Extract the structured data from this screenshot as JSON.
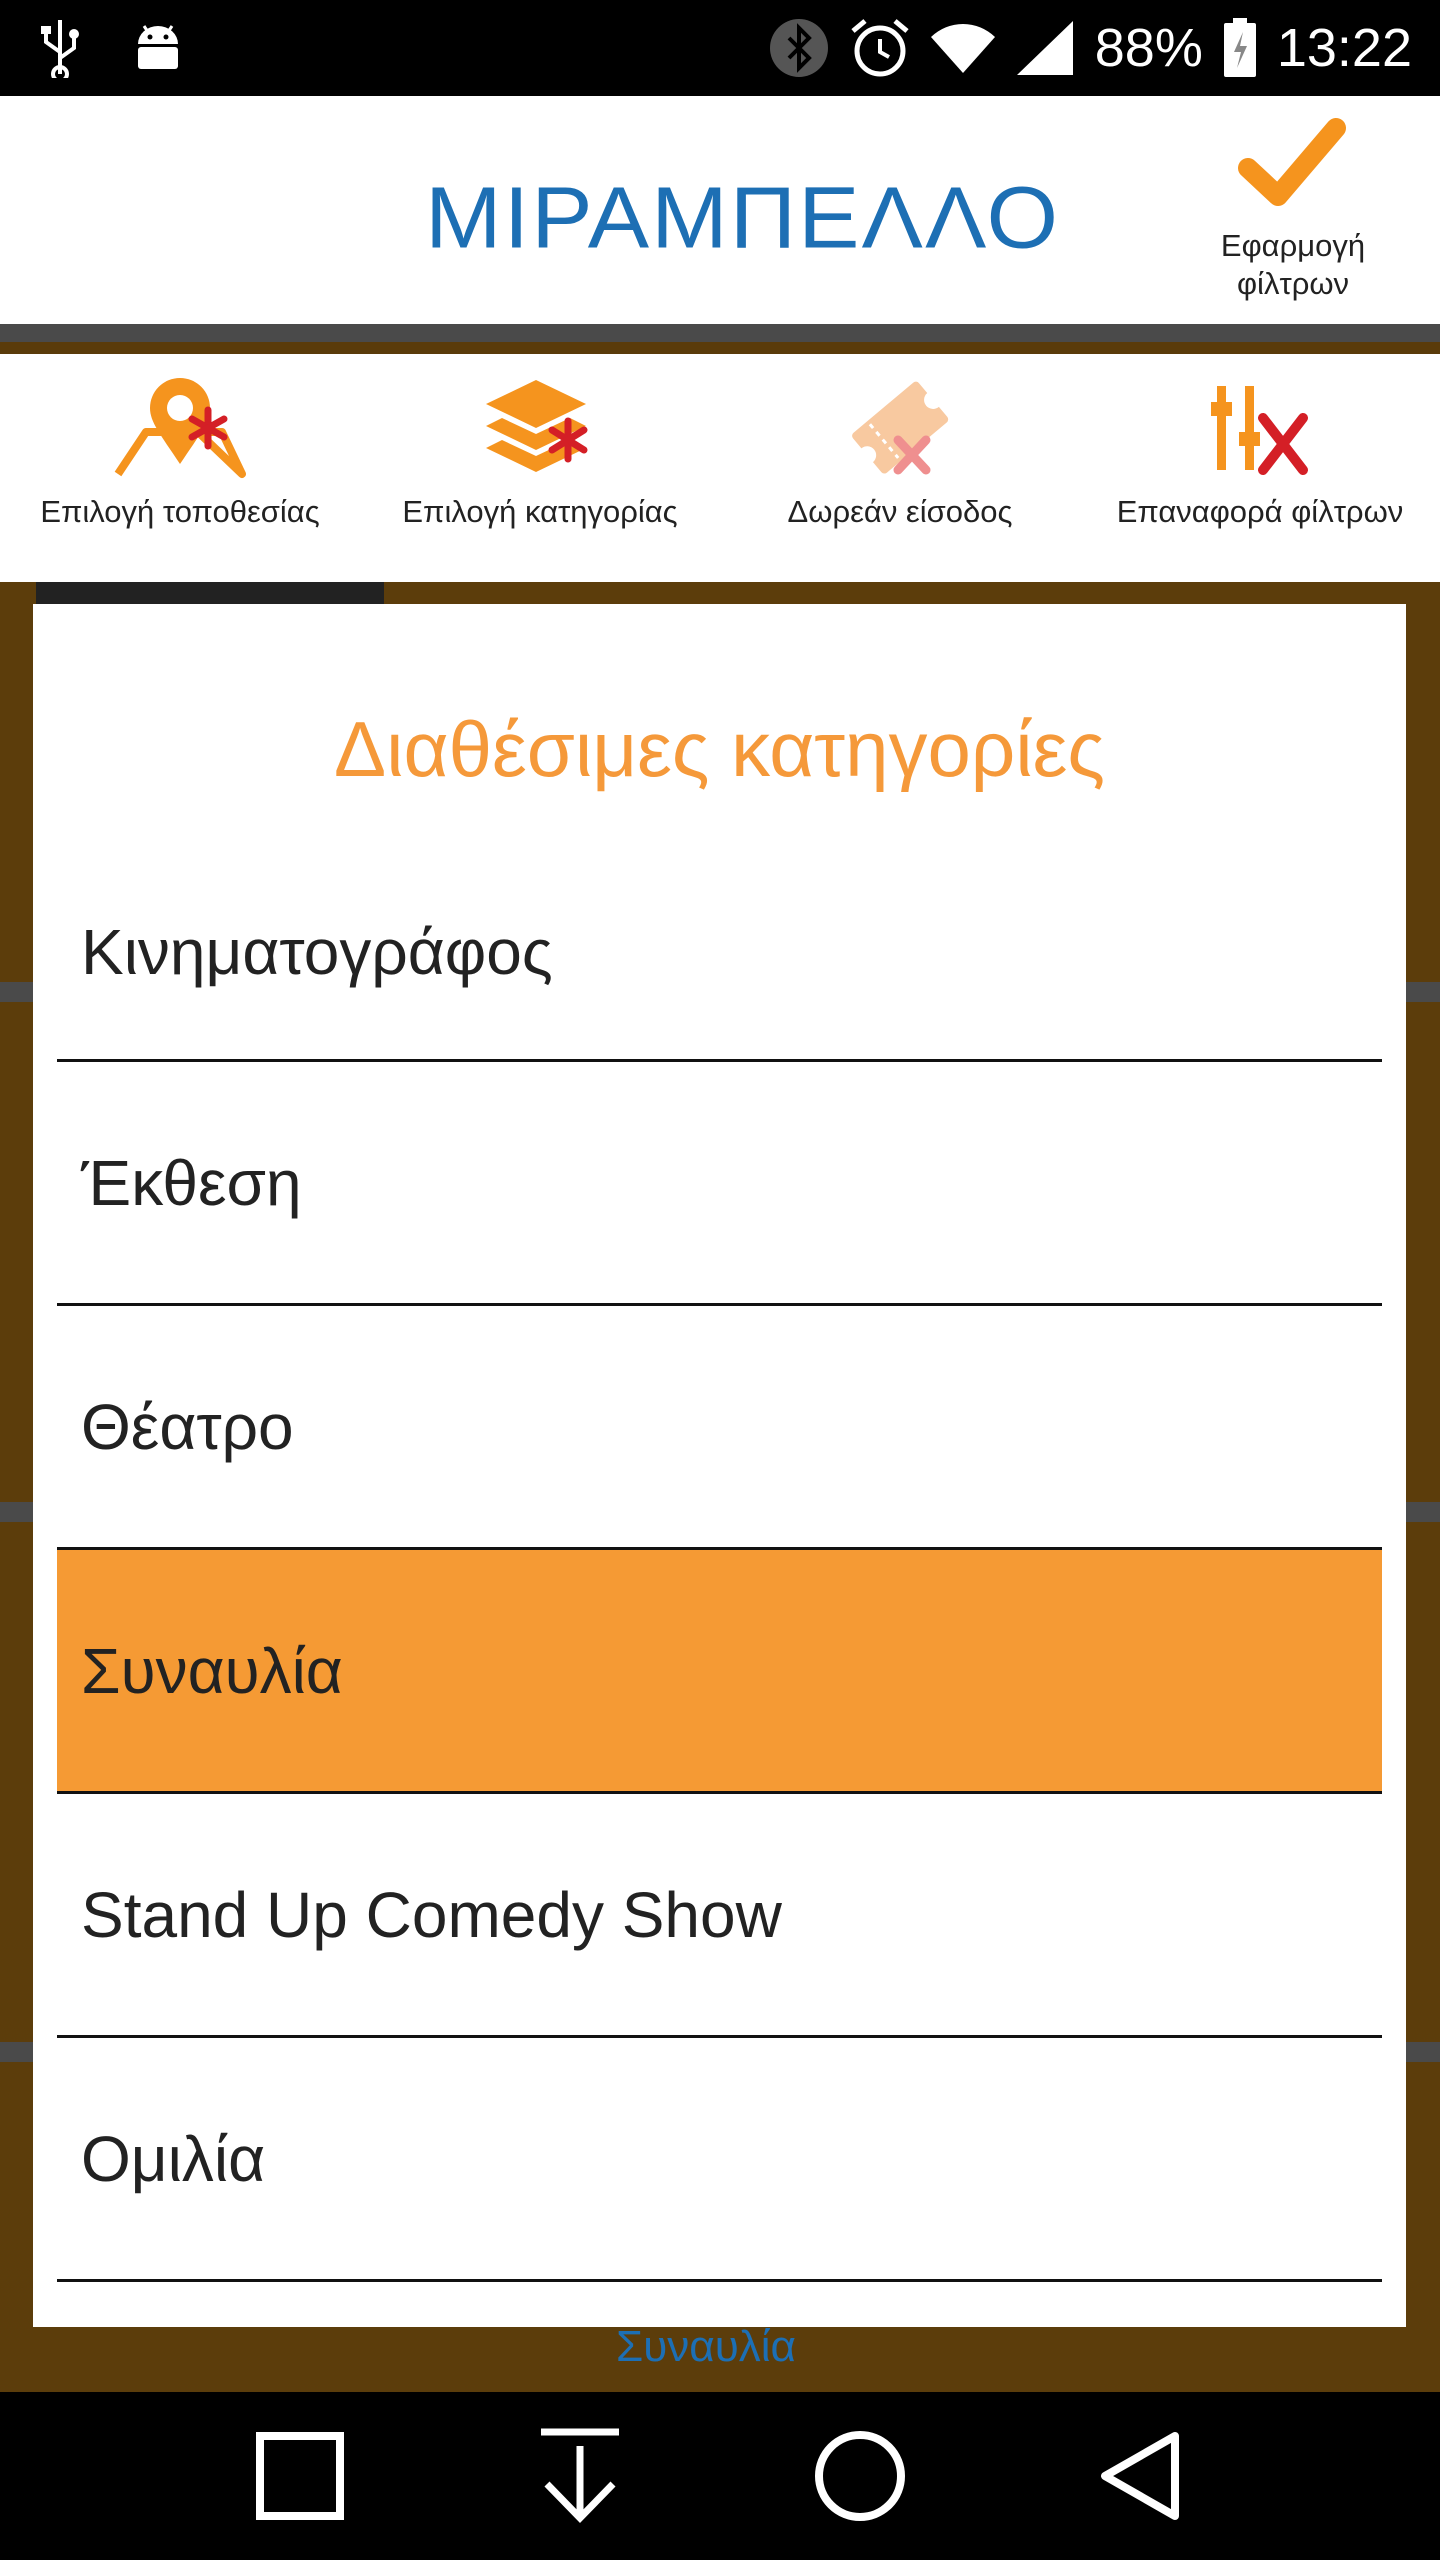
{
  "status_bar": {
    "battery_percent": "88%",
    "time": "13:22",
    "icons": [
      "usb-icon",
      "android-icon",
      "bluetooth-icon",
      "alarm-icon",
      "wifi-icon",
      "signal-icon",
      "battery-charging-icon"
    ]
  },
  "header": {
    "logo": "ΜΙΡΑΜΠΕΛΛΟ",
    "apply_filters_label": "Εφαρμογή φίλτρων"
  },
  "filter_toolbar": {
    "items": [
      {
        "label": "Επιλογή τοποθεσίας",
        "icon": "location-asterisk-icon"
      },
      {
        "label": "Επιλογή κατηγορίας",
        "icon": "layers-asterisk-icon"
      },
      {
        "label": "Δωρεάν είσοδος",
        "icon": "ticket-x-icon"
      },
      {
        "label": "Επαναφορά φίλτρων",
        "icon": "filters-reset-icon"
      }
    ]
  },
  "dialog": {
    "title": "Διαθέσιμες κατηγορίες",
    "categories": [
      {
        "label": "Κινηματογράφος",
        "selected": false
      },
      {
        "label": "Έκθεση",
        "selected": false
      },
      {
        "label": "Θέατρο",
        "selected": false
      },
      {
        "label": "Συναυλία",
        "selected": true
      },
      {
        "label": "Stand Up Comedy Show",
        "selected": false
      },
      {
        "label": "Ομιλία",
        "selected": false
      }
    ]
  },
  "background": {
    "partial_text": "Συναυλία"
  },
  "colors": {
    "accent_orange": "#f59a34",
    "logo_blue": "#1d6fb4",
    "title_orange": "#f5993a"
  },
  "nav_bar": {
    "buttons": [
      "recent-apps-icon",
      "download-icon",
      "home-icon",
      "back-icon"
    ]
  }
}
